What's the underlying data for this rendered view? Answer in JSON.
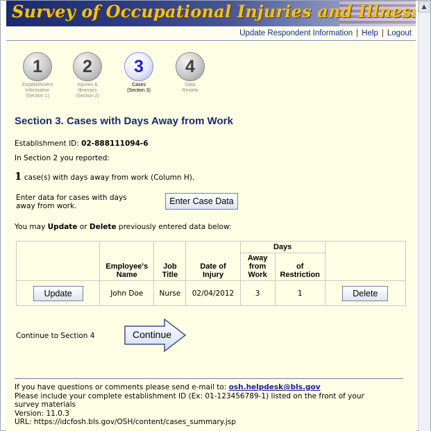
{
  "app": {
    "banner_title": "Survey of Occupational Injuries and Illnesses"
  },
  "topnav": {
    "update_respondent": "Update Respondent Information",
    "help": "Help",
    "logout": "Logout",
    "separator": "|"
  },
  "steps": [
    {
      "number": "1",
      "label_line1": "Establishment",
      "label_line2": "Information",
      "label_line3": "(Section 1)",
      "state": "inactive"
    },
    {
      "number": "2",
      "label_line1": "Injuries &",
      "label_line2": "Illnesses",
      "label_line3": "(Section 2)",
      "state": "inactive"
    },
    {
      "number": "3",
      "label_line1": "Cases",
      "label_line2": "(Section 3)",
      "label_line3": "",
      "state": "active"
    },
    {
      "number": "4",
      "label_line1": "Data",
      "label_line2": "Review",
      "label_line3": "",
      "state": "inactive"
    }
  ],
  "main": {
    "section_title": "Section 3. Cases with Days Away from Work",
    "establishment_label": "Establishment ID:",
    "establishment_id": "02-888111094-6",
    "reported_text": "In Section 2 you reported:",
    "case_count": "1",
    "case_text": "case(s) with days away from work (Column H).",
    "enter_prompt_line1": "Enter data for cases with days",
    "enter_prompt_line2": "away from work.",
    "enter_case_button": "Enter Case Data",
    "update_delete_prefix": "You may ",
    "update_word": "Update",
    "or_word": " or ",
    "delete_word": "Delete",
    "update_delete_suffix": " previously entered data below:"
  },
  "table": {
    "days_header": "Days",
    "headers": {
      "employee_name_1": "Employee's",
      "employee_name_2": "Name",
      "job_title_1": "Job",
      "job_title_2": "Title",
      "date_1": "Date of",
      "date_2": "Injury",
      "away_1": "Away",
      "away_2": "from",
      "away_3": "Work",
      "restriction_1": "of",
      "restriction_2": "Restriction"
    },
    "rows": [
      {
        "update_label": "Update",
        "employee_name": "John Doe",
        "job_title": "Nurse",
        "date_of_injury": "02/04/2012",
        "days_away": "3",
        "days_restriction": "1",
        "delete_label": "Delete"
      }
    ]
  },
  "continue": {
    "prompt": "Continue to Section 4",
    "button": "Continue"
  },
  "footer": {
    "line1_prefix": "If you have questions or comments please send e-mail to: ",
    "email": "osh.helpdesk@bls.gov",
    "line2": "Please include your complete establishment ID (Ex: 01-123456789-1) listed on the front of your",
    "line3": "survey materials",
    "version": "Version: 11.0.3",
    "url": "URL: https://idcfosh.bls.gov/OSH/content/cases_summary.jsp"
  },
  "colors": {
    "accent": "#1a2a6a",
    "banner_text": "#f2c21a",
    "page_bg": "#ffffe6",
    "link": "#0b2a8a"
  }
}
